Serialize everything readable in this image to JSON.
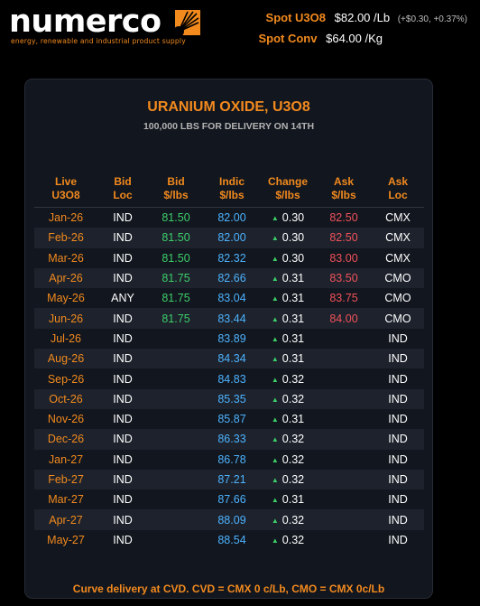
{
  "brand": {
    "name": "numerco",
    "tagline": "energy, renewable and industrial product supply",
    "accent": "#f28a1e"
  },
  "spot": {
    "u3o8_label": "Spot U3O8",
    "u3o8_value": "$82.00 /Lb",
    "u3o8_change": "(+$0.30, +0.37%)",
    "conv_label": "Spot Conv",
    "conv_value": "$64.00 /Kg"
  },
  "panel": {
    "title": "URANIUM OXIDE, U3O8",
    "subtitle": "100,000 LBS FOR DELIVERY ON 14TH",
    "footer": "Curve delivery at CVD. CVD = CMX 0 c/Lb, CMO = CMX 0c/Lb"
  },
  "table": {
    "headers": [
      [
        "Live",
        "U3O8"
      ],
      [
        "Bid",
        "Loc"
      ],
      [
        "Bid",
        "$/lbs"
      ],
      [
        "Indic",
        "$/lbs"
      ],
      [
        "Change",
        "$/lbs"
      ],
      [
        "Ask",
        "$/lbs"
      ],
      [
        "Ask",
        "Loc"
      ]
    ],
    "rows": [
      {
        "month": "Jan-26",
        "bid_loc": "IND",
        "bid": "81.50",
        "indic": "82.00",
        "change": "0.30",
        "ask": "82.50",
        "ask_loc": "CMX"
      },
      {
        "month": "Feb-26",
        "bid_loc": "IND",
        "bid": "81.50",
        "indic": "82.00",
        "change": "0.30",
        "ask": "82.50",
        "ask_loc": "CMX"
      },
      {
        "month": "Mar-26",
        "bid_loc": "IND",
        "bid": "81.50",
        "indic": "82.32",
        "change": "0.30",
        "ask": "83.00",
        "ask_loc": "CMX"
      },
      {
        "month": "Apr-26",
        "bid_loc": "IND",
        "bid": "81.75",
        "indic": "82.66",
        "change": "0.31",
        "ask": "83.50",
        "ask_loc": "CMO"
      },
      {
        "month": "May-26",
        "bid_loc": "ANY",
        "bid": "81.75",
        "indic": "83.04",
        "change": "0.31",
        "ask": "83.75",
        "ask_loc": "CMO"
      },
      {
        "month": "Jun-26",
        "bid_loc": "IND",
        "bid": "81.75",
        "indic": "83.44",
        "change": "0.31",
        "ask": "84.00",
        "ask_loc": "CMO"
      },
      {
        "month": "Jul-26",
        "bid_loc": "IND",
        "bid": "",
        "indic": "83.89",
        "change": "0.31",
        "ask": "",
        "ask_loc": "IND"
      },
      {
        "month": "Aug-26",
        "bid_loc": "IND",
        "bid": "",
        "indic": "84.34",
        "change": "0.31",
        "ask": "",
        "ask_loc": "IND"
      },
      {
        "month": "Sep-26",
        "bid_loc": "IND",
        "bid": "",
        "indic": "84.83",
        "change": "0.32",
        "ask": "",
        "ask_loc": "IND"
      },
      {
        "month": "Oct-26",
        "bid_loc": "IND",
        "bid": "",
        "indic": "85.35",
        "change": "0.32",
        "ask": "",
        "ask_loc": "IND"
      },
      {
        "month": "Nov-26",
        "bid_loc": "IND",
        "bid": "",
        "indic": "85.87",
        "change": "0.31",
        "ask": "",
        "ask_loc": "IND"
      },
      {
        "month": "Dec-26",
        "bid_loc": "IND",
        "bid": "",
        "indic": "86.33",
        "change": "0.32",
        "ask": "",
        "ask_loc": "IND"
      },
      {
        "month": "Jan-27",
        "bid_loc": "IND",
        "bid": "",
        "indic": "86.78",
        "change": "0.32",
        "ask": "",
        "ask_loc": "IND"
      },
      {
        "month": "Feb-27",
        "bid_loc": "IND",
        "bid": "",
        "indic": "87.21",
        "change": "0.32",
        "ask": "",
        "ask_loc": "IND"
      },
      {
        "month": "Mar-27",
        "bid_loc": "IND",
        "bid": "",
        "indic": "87.66",
        "change": "0.31",
        "ask": "",
        "ask_loc": "IND"
      },
      {
        "month": "Apr-27",
        "bid_loc": "IND",
        "bid": "",
        "indic": "88.09",
        "change": "0.32",
        "ask": "",
        "ask_loc": "IND"
      },
      {
        "month": "May-27",
        "bid_loc": "IND",
        "bid": "",
        "indic": "88.54",
        "change": "0.32",
        "ask": "",
        "ask_loc": "IND"
      }
    ],
    "change_icon": "triangle-up-icon",
    "colors": {
      "bid": "#3dcf6a",
      "indic": "#4db3ff",
      "ask": "#f0525a",
      "up": "#3dcf6a"
    }
  }
}
